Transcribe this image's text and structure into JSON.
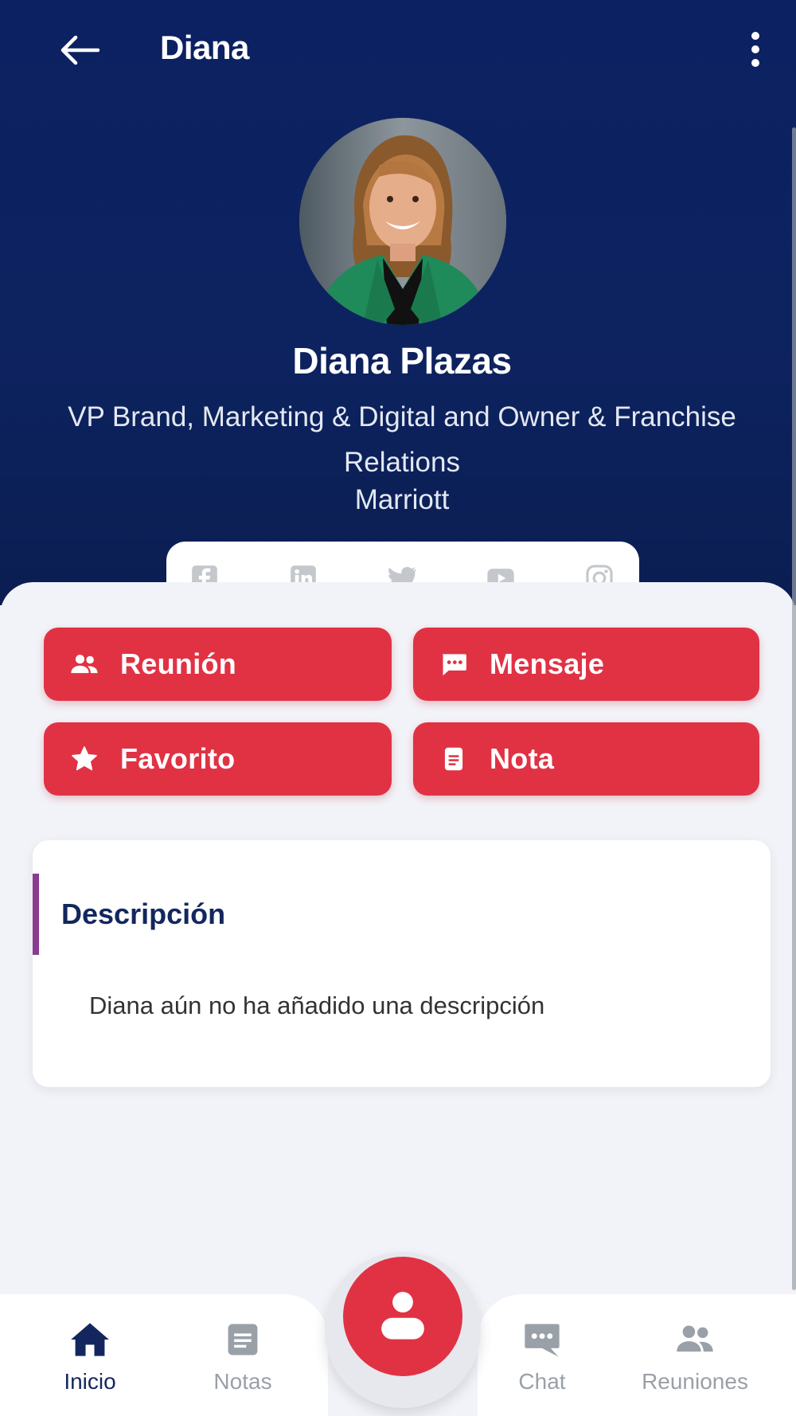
{
  "header": {
    "title": "Diana"
  },
  "profile": {
    "name": "Diana Plazas",
    "role": "VP Brand, Marketing & Digital and Owner & Franchise Relations",
    "company": "Marriott"
  },
  "social": [
    "facebook-icon",
    "linkedin-icon",
    "twitter-icon",
    "youtube-icon",
    "instagram-icon"
  ],
  "actions": {
    "meeting": "Reunión",
    "message": "Mensaje",
    "favorite": "Favorito",
    "note": "Nota"
  },
  "description": {
    "title": "Descripción",
    "text": "Diana aún no ha añadido una descripción"
  },
  "tabs": {
    "home": "Inicio",
    "notes": "Notas",
    "chat": "Chat",
    "meetings": "Reuniones"
  },
  "colors": {
    "header_bg": "#0c2161",
    "accent_red": "#e13244",
    "title_navy": "#13275e",
    "accent_purple": "#8a3b8f",
    "inactive_gray": "#9aa0a8"
  }
}
